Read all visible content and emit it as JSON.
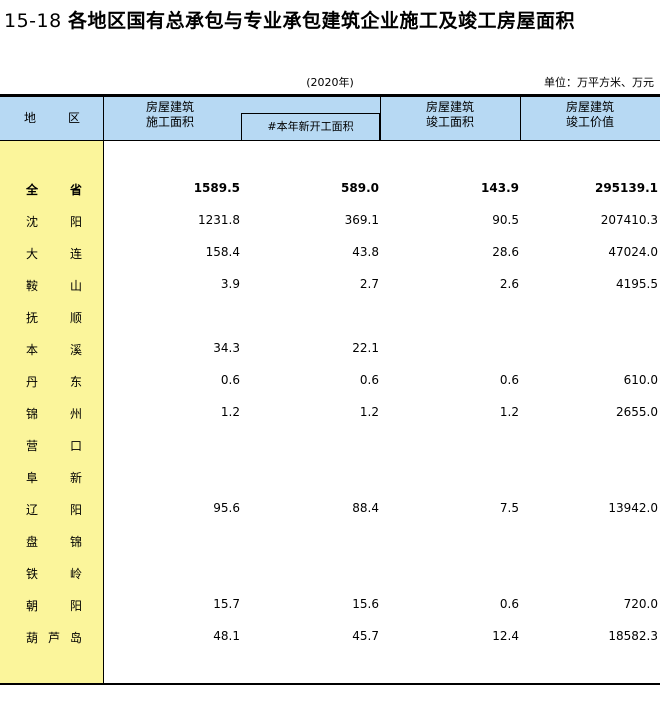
{
  "header": {
    "number": "15-18",
    "title": "各地区国有总承包与专业承包建筑企业施工及竣工房屋面积",
    "year": "(2020年)",
    "unit": "单位：万平方米、万元"
  },
  "columns": {
    "region_a": "地",
    "region_b": "区",
    "col1_line1": "房屋建筑",
    "col1_line2": "施工面积",
    "col1_sub": "#本年新开工面积",
    "col3_line1": "房屋建筑",
    "col3_line2": "竣工面积",
    "col4_line1": "房屋建筑",
    "col4_line2": "竣工价值"
  },
  "rows": [
    {
      "name_a": "全",
      "name_b": "",
      "name_c": "省",
      "c1": "1589.5",
      "c2": "589.0",
      "c3": "143.9",
      "c4": "295139.1"
    },
    {
      "name_a": "沈",
      "name_b": "",
      "name_c": "阳",
      "c1": "1231.8",
      "c2": "369.1",
      "c3": "90.5",
      "c4": "207410.3"
    },
    {
      "name_a": "大",
      "name_b": "",
      "name_c": "连",
      "c1": "158.4",
      "c2": "43.8",
      "c3": "28.6",
      "c4": "47024.0"
    },
    {
      "name_a": "鞍",
      "name_b": "",
      "name_c": "山",
      "c1": "3.9",
      "c2": "2.7",
      "c3": "2.6",
      "c4": "4195.5"
    },
    {
      "name_a": "抚",
      "name_b": "",
      "name_c": "顺",
      "c1": "",
      "c2": "",
      "c3": "",
      "c4": ""
    },
    {
      "name_a": "本",
      "name_b": "",
      "name_c": "溪",
      "c1": "34.3",
      "c2": "22.1",
      "c3": "",
      "c4": ""
    },
    {
      "name_a": "丹",
      "name_b": "",
      "name_c": "东",
      "c1": "0.6",
      "c2": "0.6",
      "c3": "0.6",
      "c4": "610.0"
    },
    {
      "name_a": "锦",
      "name_b": "",
      "name_c": "州",
      "c1": "1.2",
      "c2": "1.2",
      "c3": "1.2",
      "c4": "2655.0"
    },
    {
      "name_a": "营",
      "name_b": "",
      "name_c": "口",
      "c1": "",
      "c2": "",
      "c3": "",
      "c4": ""
    },
    {
      "name_a": "阜",
      "name_b": "",
      "name_c": "新",
      "c1": "",
      "c2": "",
      "c3": "",
      "c4": ""
    },
    {
      "name_a": "辽",
      "name_b": "",
      "name_c": "阳",
      "c1": "95.6",
      "c2": "88.4",
      "c3": "7.5",
      "c4": "13942.0"
    },
    {
      "name_a": "盘",
      "name_b": "",
      "name_c": "锦",
      "c1": "",
      "c2": "",
      "c3": "",
      "c4": ""
    },
    {
      "name_a": "铁",
      "name_b": "",
      "name_c": "岭",
      "c1": "",
      "c2": "",
      "c3": "",
      "c4": ""
    },
    {
      "name_a": "朝",
      "name_b": "",
      "name_c": "阳",
      "c1": "15.7",
      "c2": "15.6",
      "c3": "0.6",
      "c4": "720.0"
    },
    {
      "name_a": "葫",
      "name_b": "芦",
      "name_c": "岛",
      "c1": "48.1",
      "c2": "45.7",
      "c3": "12.4",
      "c4": "18582.3"
    }
  ]
}
